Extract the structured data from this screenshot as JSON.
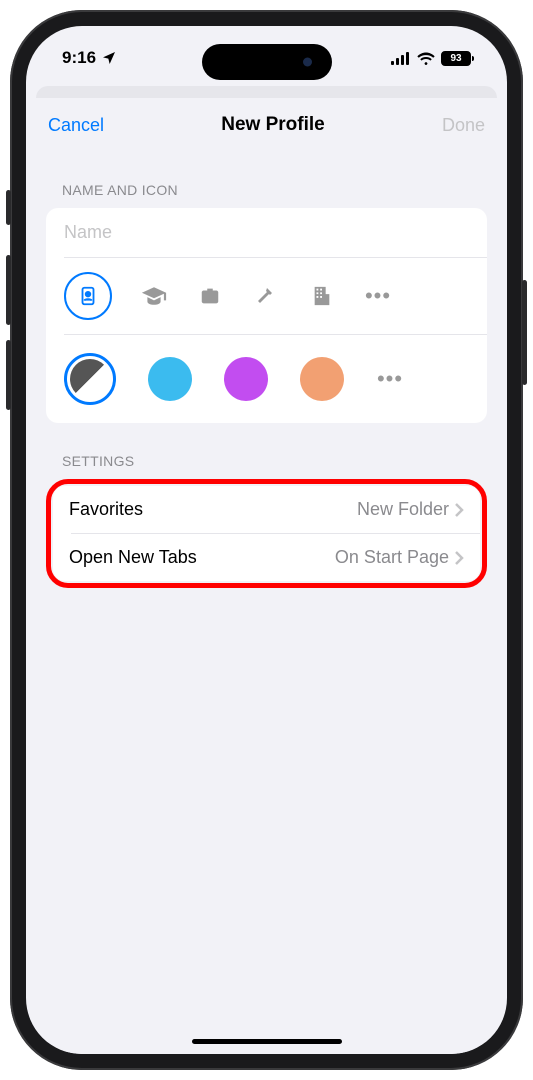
{
  "status": {
    "time": "9:16",
    "battery": "93"
  },
  "nav": {
    "cancel": "Cancel",
    "title": "New Profile",
    "done": "Done"
  },
  "sections": {
    "nameAndIcon": "NAME AND ICON",
    "settings": "SETTINGS"
  },
  "nameField": {
    "placeholder": "Name",
    "value": ""
  },
  "icons": [
    {
      "name": "profile-card-icon",
      "selected": true
    },
    {
      "name": "graduation-cap-icon",
      "selected": false
    },
    {
      "name": "briefcase-icon",
      "selected": false
    },
    {
      "name": "hammer-icon",
      "selected": false
    },
    {
      "name": "building-icon",
      "selected": false
    },
    {
      "name": "more-icons",
      "selected": false
    }
  ],
  "colors": {
    "selected": "#555555",
    "options": [
      "#3bbbef",
      "#c24df0",
      "#f2a072"
    ],
    "moreLabel": "more-colors"
  },
  "settings": {
    "favorites": {
      "label": "Favorites",
      "value": "New Folder"
    },
    "openNewTabs": {
      "label": "Open New Tabs",
      "value": "On Start Page"
    }
  }
}
